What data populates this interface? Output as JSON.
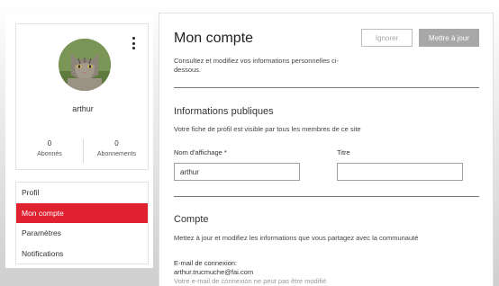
{
  "profile": {
    "username": "arthur",
    "followers_count": "0",
    "followers_label": "Abonnés",
    "following_count": "0",
    "following_label": "Abonnements"
  },
  "sidebar": {
    "items": [
      {
        "label": "Profil"
      },
      {
        "label": "Mon compte"
      },
      {
        "label": "Paramètres"
      },
      {
        "label": "Notifications"
      }
    ],
    "active_index": 1,
    "active_color": "#e0212f"
  },
  "page": {
    "title": "Mon compte",
    "subtitle": "Consultez et modifiez vos informations personnelles ci-dessous.",
    "ignore_label": "Ignorer",
    "update_label": "Mettre à jour"
  },
  "public_info": {
    "title": "Informations publiques",
    "description": "Votre fiche de profil est visible par tous les membres de ce site",
    "display_name_label": "Nom d'affichage *",
    "display_name_value": "arthur",
    "title_label": "Titre",
    "title_value": ""
  },
  "account": {
    "title": "Compte",
    "description": "Mettez à jour et modifiez les informations que vous partagez avec la communauté",
    "email_label": "E-mail de connexion:",
    "email_value": "arthur.trucmuche@fai.com",
    "email_note": "Votre e-mail de connexion ne peut pas être modifié"
  },
  "icons": {
    "menu": "kebab-menu-icon",
    "avatar": "cat-avatar"
  }
}
